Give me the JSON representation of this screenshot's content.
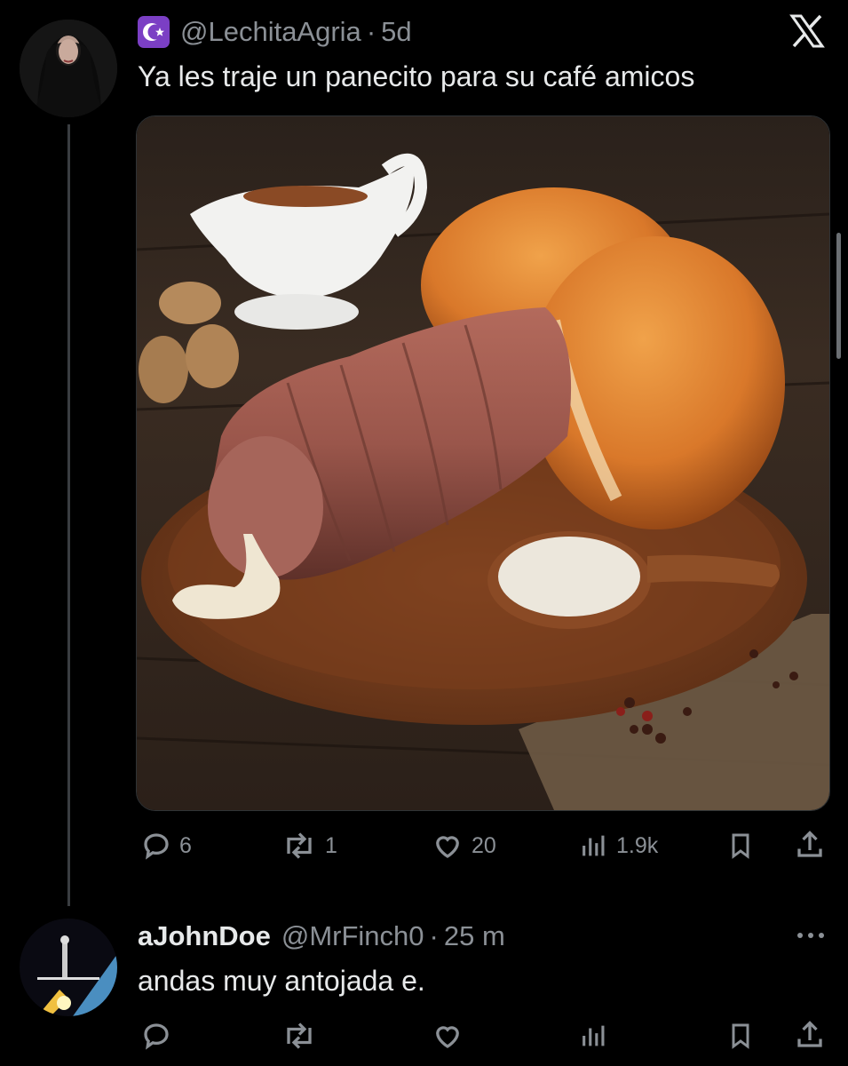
{
  "platform_logo": "x-logo-icon",
  "tweet": {
    "handle": "@LechitaAgria",
    "separator": "·",
    "time": "5d",
    "text": "Ya les traje un panecito para su café amicos",
    "badge_icon": "crescent-star-icon",
    "media_description_icons": [
      "bread-roll",
      "meat",
      "gravy-boat",
      "cutting-board"
    ],
    "actions": {
      "replies": "6",
      "retweets": "1",
      "likes": "20",
      "views": "1.9k"
    }
  },
  "reply": {
    "display_name": "aJohnDoe",
    "handle": "@MrFinch0",
    "separator": "·",
    "time": "25 m",
    "text": "andas muy antojada e.",
    "more_icon": "more-dots-icon"
  },
  "colors": {
    "background": "#000000",
    "text": "#e7e9ea",
    "muted": "#8b9096",
    "badge": "#7b3fc4"
  }
}
